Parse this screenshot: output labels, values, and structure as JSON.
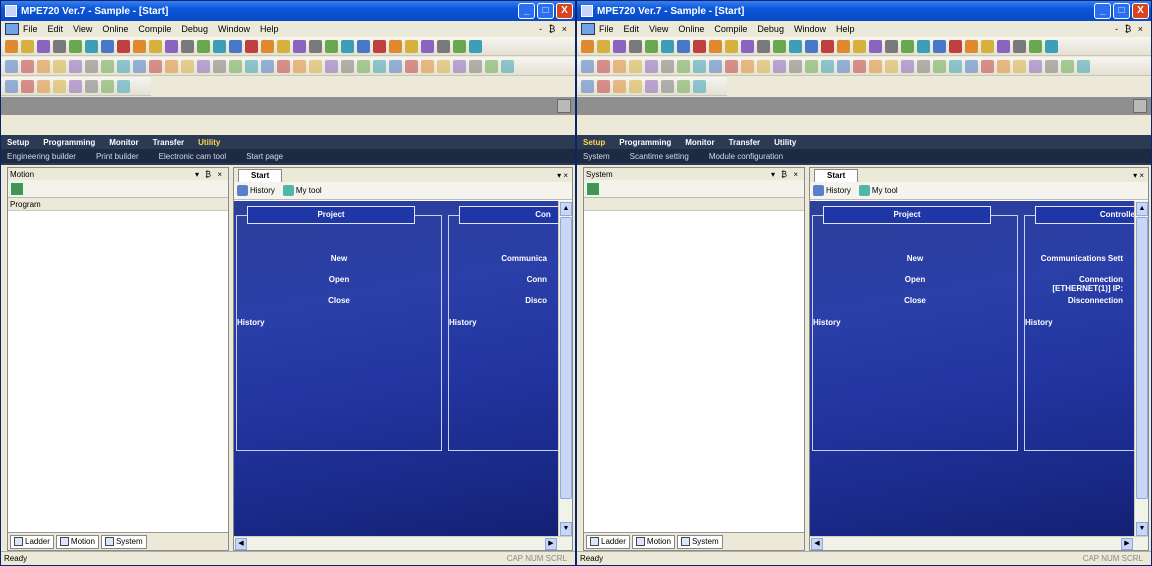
{
  "left": {
    "window_title": "MPE720 Ver.7 - Sample - [Start]",
    "window_buttons": {
      "minimize": "_",
      "maximize": "□",
      "close": "X"
    },
    "menu": [
      "File",
      "Edit",
      "View",
      "Online",
      "Compile",
      "Debug",
      "Window",
      "Help"
    ],
    "mdi_controls": "- ₿ ×",
    "ribbon_tabs": [
      "Setup",
      "Programming",
      "Monitor",
      "Transfer",
      "Utility"
    ],
    "active_ribbon_tab": "Utility",
    "ribbon_subitems": [
      "Engineering builder",
      "Print builder",
      "Electronic cam tool",
      "Start page"
    ],
    "pane_title": "Motion",
    "pane_controls": "▾ ₿ ×",
    "list_header": "Program",
    "bottom_tabs": [
      "Ladder",
      "Motion",
      "System"
    ],
    "doc_tab": "Start",
    "doc_tab_controls": "▾ ×",
    "links": [
      "History",
      "My tool"
    ],
    "project_header": "Project",
    "project_items": [
      "New",
      "Open",
      "Close"
    ],
    "history_label": "History",
    "controller_header": "Con",
    "controller_items": [
      "Communica",
      "Conn",
      "Disco"
    ],
    "controller_history": "History",
    "status_text": "Ready",
    "status_keys": "CAP NUM SCRL"
  },
  "right": {
    "window_title": "MPE720 Ver.7 - Sample - [Start]",
    "window_buttons": {
      "minimize": "_",
      "maximize": "□",
      "close": "X"
    },
    "menu": [
      "File",
      "Edit",
      "View",
      "Online",
      "Compile",
      "Debug",
      "Window",
      "Help"
    ],
    "mdi_controls": "- ₿ ×",
    "ribbon_tabs": [
      "Setup",
      "Programming",
      "Monitor",
      "Transfer",
      "Utility"
    ],
    "active_ribbon_tab": "Setup",
    "ribbon_subitems": [
      "System",
      "Scantime setting",
      "Module configuration"
    ],
    "pane_title": "System",
    "pane_controls": "▾ ₿ ×",
    "list_header": "",
    "bottom_tabs": [
      "Ladder",
      "Motion",
      "System"
    ],
    "doc_tab": "Start",
    "doc_tab_controls": "▾ ×",
    "links": [
      "History",
      "My tool"
    ],
    "project_header": "Project",
    "project_items": [
      "New",
      "Open",
      "Close"
    ],
    "history_label": "History",
    "controller_header": "Controller",
    "controller_items": [
      "Communications Sett",
      "Connection [ETHERNET(1)] IP:",
      "Disconnection"
    ],
    "controller_history": "History",
    "status_text": "Ready",
    "status_keys": "CAP NUM SCRL"
  },
  "colors": {
    "titlebar": "#0a56d8",
    "ribbon": "#2b3a55",
    "start_page": "#2235a0",
    "active_tab": "#ffd84a"
  }
}
